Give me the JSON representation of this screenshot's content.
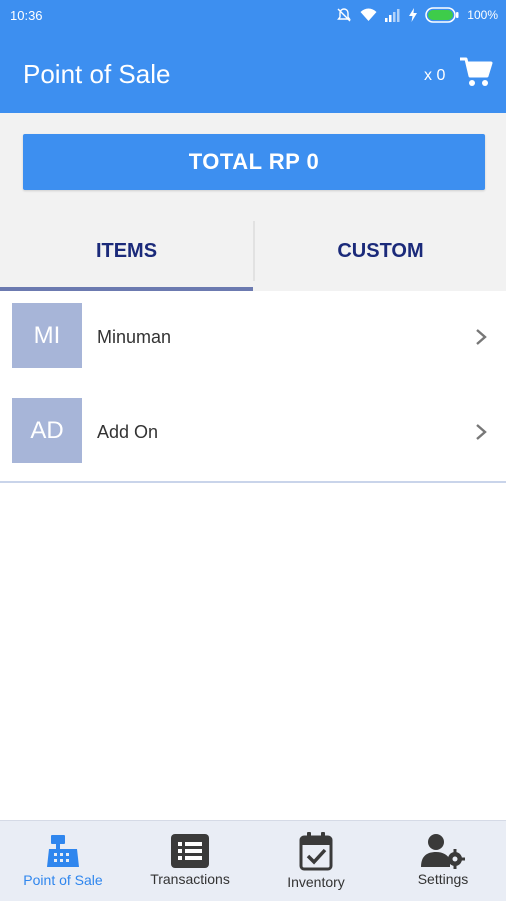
{
  "status_bar": {
    "time": "10:36",
    "battery": "100%",
    "icons": [
      "mute-icon",
      "wifi-icon",
      "signal-icon",
      "charging-icon",
      "battery-icon"
    ]
  },
  "app_bar": {
    "title": "Point of Sale",
    "cart_count": "x 0",
    "cart_icon": "shopping-cart-icon"
  },
  "total": {
    "label": "TOTAL RP 0"
  },
  "tabs": [
    {
      "label": "ITEMS",
      "active": true
    },
    {
      "label": "CUSTOM",
      "active": false
    }
  ],
  "categories": [
    {
      "initials": "MI",
      "name": "Minuman"
    },
    {
      "initials": "AD",
      "name": "Add On"
    }
  ],
  "bottom_nav": [
    {
      "label": "Point of Sale",
      "icon": "cash-register-icon",
      "active": true
    },
    {
      "label": "Transactions",
      "icon": "list-icon",
      "active": false
    },
    {
      "label": "Inventory",
      "icon": "calendar-check-icon",
      "active": false
    },
    {
      "label": "Settings",
      "icon": "user-gear-icon",
      "active": false
    }
  ],
  "colors": {
    "primary": "#3d8ff0",
    "tab_text": "#1b2a7a",
    "avatar_bg": "#a7b5d8",
    "nav_active": "#2f86ee"
  }
}
